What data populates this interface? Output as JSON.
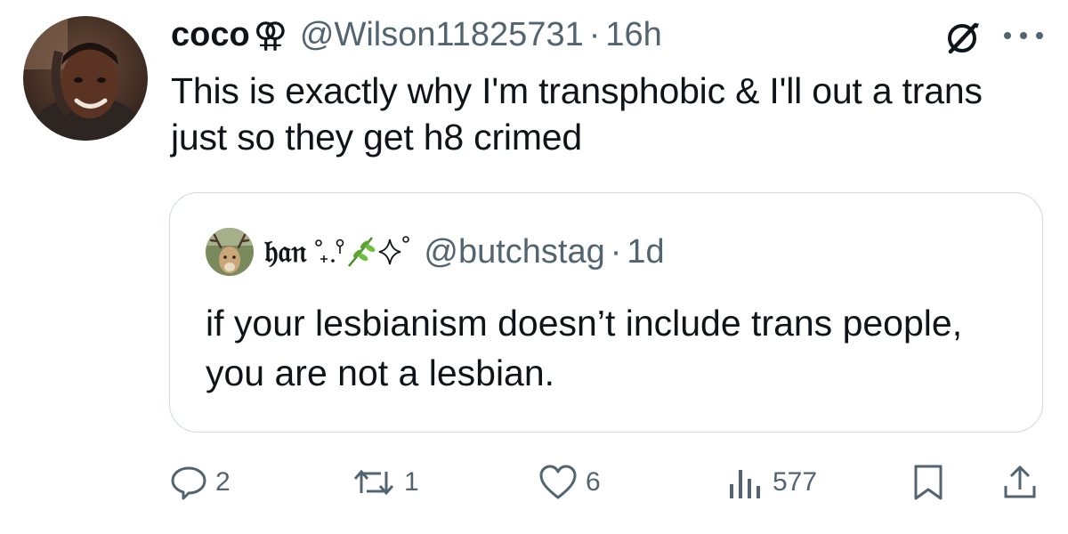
{
  "tweet": {
    "display_name": "coco",
    "name_glyph": "⚢",
    "handle": "@Wilson11825731",
    "separator": "·",
    "time": "16h",
    "text": "This is exactly why I'm transphobic & I'll out a trans just so they get h8 crimed"
  },
  "quote": {
    "display_name": "𝔥𝔞𝔫",
    "name_decoration": "°₊⚲ 🌿✧°",
    "handle": "@butchstag",
    "separator": "·",
    "time": "1d",
    "text": "if your lesbianism doesn’t include trans people, you are not a lesbian."
  },
  "actions": {
    "replies": "2",
    "reposts": "1",
    "likes": "6",
    "views": "577"
  },
  "icons": {
    "grok": "grok-icon",
    "more": "more-icon",
    "reply": "reply-icon",
    "repost": "repost-icon",
    "like": "heart-icon",
    "views": "views-icon",
    "bookmark": "bookmark-icon",
    "share": "share-icon"
  },
  "colors": {
    "text": "#0f1419",
    "secondary": "#536471",
    "border": "#cfd9de"
  }
}
